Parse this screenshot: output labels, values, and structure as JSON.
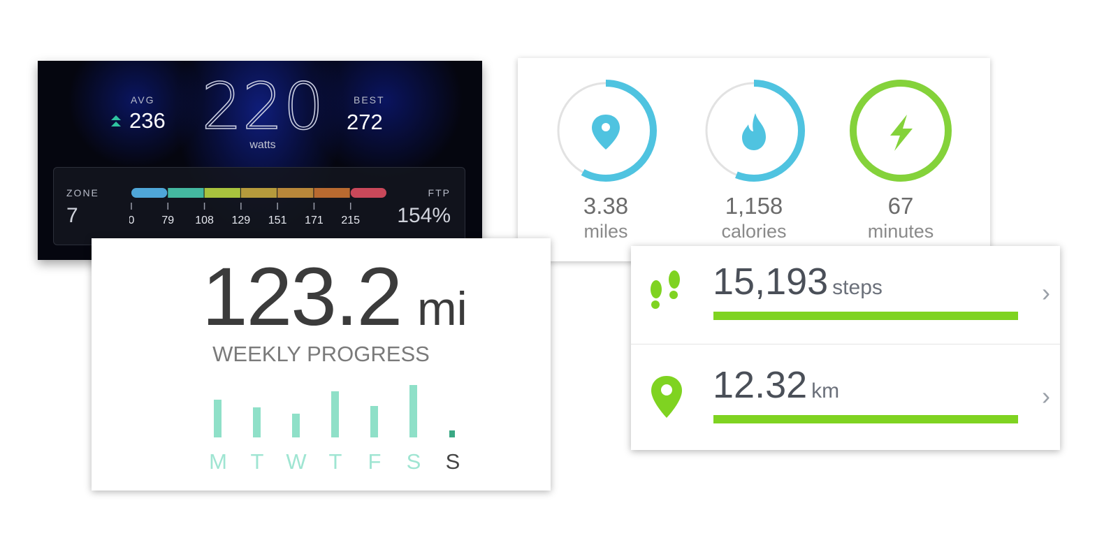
{
  "power": {
    "avg_label": "AVG",
    "avg_value": "236",
    "current_value": "220",
    "current_unit": "watts",
    "best_label": "BEST",
    "best_value": "272",
    "zone_label": "ZONE",
    "zone_value": "7",
    "ftp_label": "FTP",
    "ftp_value": "154%",
    "zone_ticks": [
      "0",
      "79",
      "108",
      "129",
      "151",
      "171",
      "215"
    ],
    "zone_colors": [
      "#4fa6d8",
      "#44b8a0",
      "#a8c23e",
      "#b59a3c",
      "#b8873a",
      "#b86a30",
      "#c9485a"
    ]
  },
  "rings": [
    {
      "value": "3.38",
      "unit": "miles",
      "icon": "map-pin-icon",
      "color": "#4fc3e0",
      "progress": 0.58
    },
    {
      "value": "1,158",
      "unit": "calories",
      "icon": "flame-icon",
      "color": "#4fc3e0",
      "progress": 0.56
    },
    {
      "value": "67",
      "unit": "minutes",
      "icon": "lightning-icon",
      "color": "#84d23a",
      "progress": 1.0
    }
  ],
  "weekly": {
    "total": "123.2",
    "unit": "mi",
    "label": "WEEKLY PROGRESS",
    "days": [
      "M",
      "T",
      "W",
      "T",
      "F",
      "S",
      "S"
    ],
    "relative_values": [
      0.72,
      0.58,
      0.46,
      0.88,
      0.6,
      1.0,
      0.14
    ],
    "bar_color": "#8fe0c8",
    "today_color": "#3aa884"
  },
  "activity": [
    {
      "value": "15,193",
      "unit": "steps",
      "icon": "footsteps-icon",
      "progress": 1.0
    },
    {
      "value": "12.32",
      "unit": "km",
      "icon": "map-pin-icon",
      "progress": 1.0
    }
  ],
  "accent_green": "#7fd321"
}
